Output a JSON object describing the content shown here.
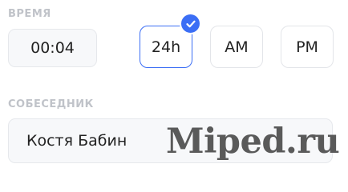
{
  "time_section": {
    "label": "ВРЕМЯ",
    "value": "00:04",
    "formats": [
      {
        "label": "24h",
        "selected": true
      },
      {
        "label": "AM",
        "selected": false
      },
      {
        "label": "PM",
        "selected": false
      }
    ]
  },
  "partner_section": {
    "label": "СОБЕСЕДНИК",
    "value": "Костя Бабин"
  },
  "watermark": "Miped.ru",
  "colors": {
    "accent": "#3b6ef5",
    "label": "#c0c3c9",
    "field_bg": "#f7f8fa",
    "border": "#e6e8ec"
  }
}
